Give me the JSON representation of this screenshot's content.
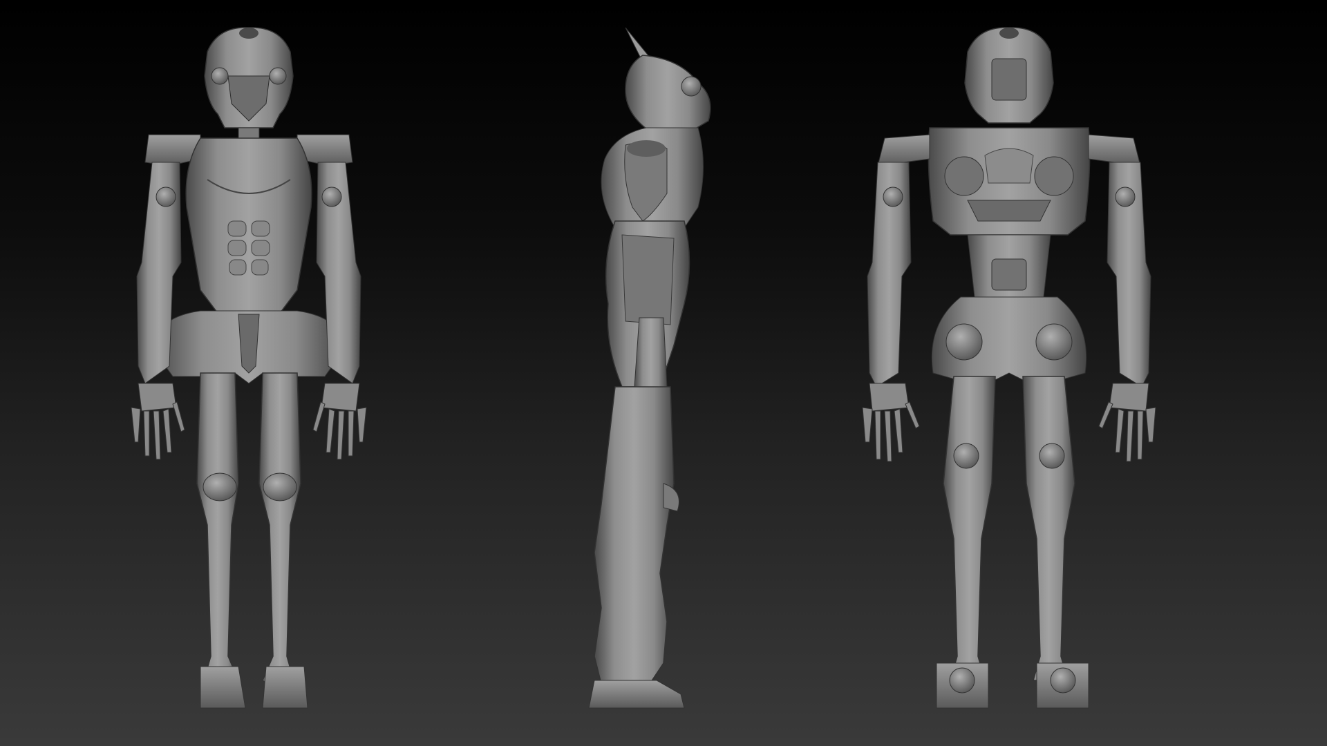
{
  "scene": {
    "type": "sculpt-turnaround",
    "views": [
      {
        "name": "front-view"
      },
      {
        "name": "side-view"
      },
      {
        "name": "back-view"
      }
    ],
    "colors": {
      "background_top": "#000000",
      "background_bottom": "#3a3a3a",
      "material": "#8a8a8a"
    }
  }
}
